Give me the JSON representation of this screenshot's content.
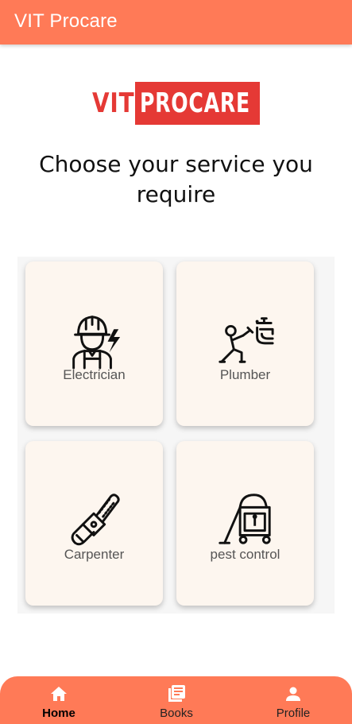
{
  "appbar": {
    "title": "VIT Procare"
  },
  "logo": {
    "part1": "VIT",
    "part2": "PROCARE"
  },
  "headline": "Choose your service you require",
  "services": [
    {
      "label": "Electrician",
      "icon": "electrician-icon"
    },
    {
      "label": "Plumber",
      "icon": "plumber-icon"
    },
    {
      "label": "Carpenter",
      "icon": "chainsaw-icon"
    },
    {
      "label": "pest control",
      "icon": "vacuum-icon"
    }
  ],
  "bottom_nav": {
    "items": [
      {
        "label": "Home",
        "icon": "home-icon",
        "active": true
      },
      {
        "label": "Books",
        "icon": "books-icon",
        "active": false
      },
      {
        "label": "Profile",
        "icon": "person-icon",
        "active": false
      }
    ]
  },
  "colors": {
    "accent": "#ff7a57",
    "logo_red": "#e53935",
    "card_bg": "#fdf6ef"
  }
}
